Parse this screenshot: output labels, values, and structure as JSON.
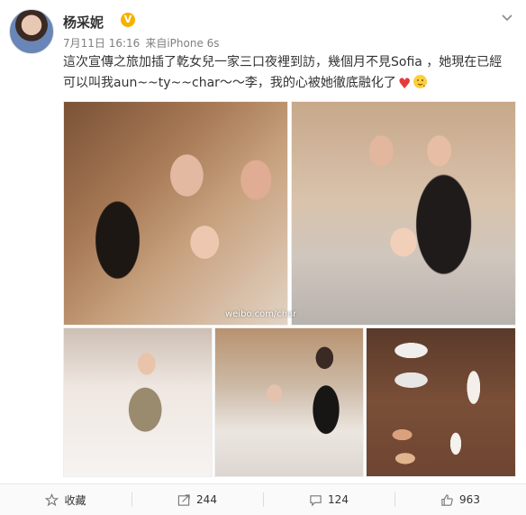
{
  "post": {
    "username": "杨采妮",
    "verified_badge": "V",
    "date": "7月11日 16:16",
    "source_prefix": "来自",
    "device": "iPhone 6s",
    "text_main": "這次宣傳之旅加插了乾女兒一家三口夜裡到訪，幾個月不見Sofia ，她現在已經可以叫我aun~~ty~~char～～李，我的心被她徹底融化了",
    "emojis": [
      "heart-icon",
      "wink-face-icon"
    ],
    "watermark": "weibo.com/char"
  },
  "actions": {
    "favorite_label": "收藏",
    "repost_count": "244",
    "comment_count": "124",
    "like_count": "963"
  },
  "colors": {
    "accent": "#f6b100",
    "heart": "#e53b3b",
    "muted": "#808080"
  }
}
